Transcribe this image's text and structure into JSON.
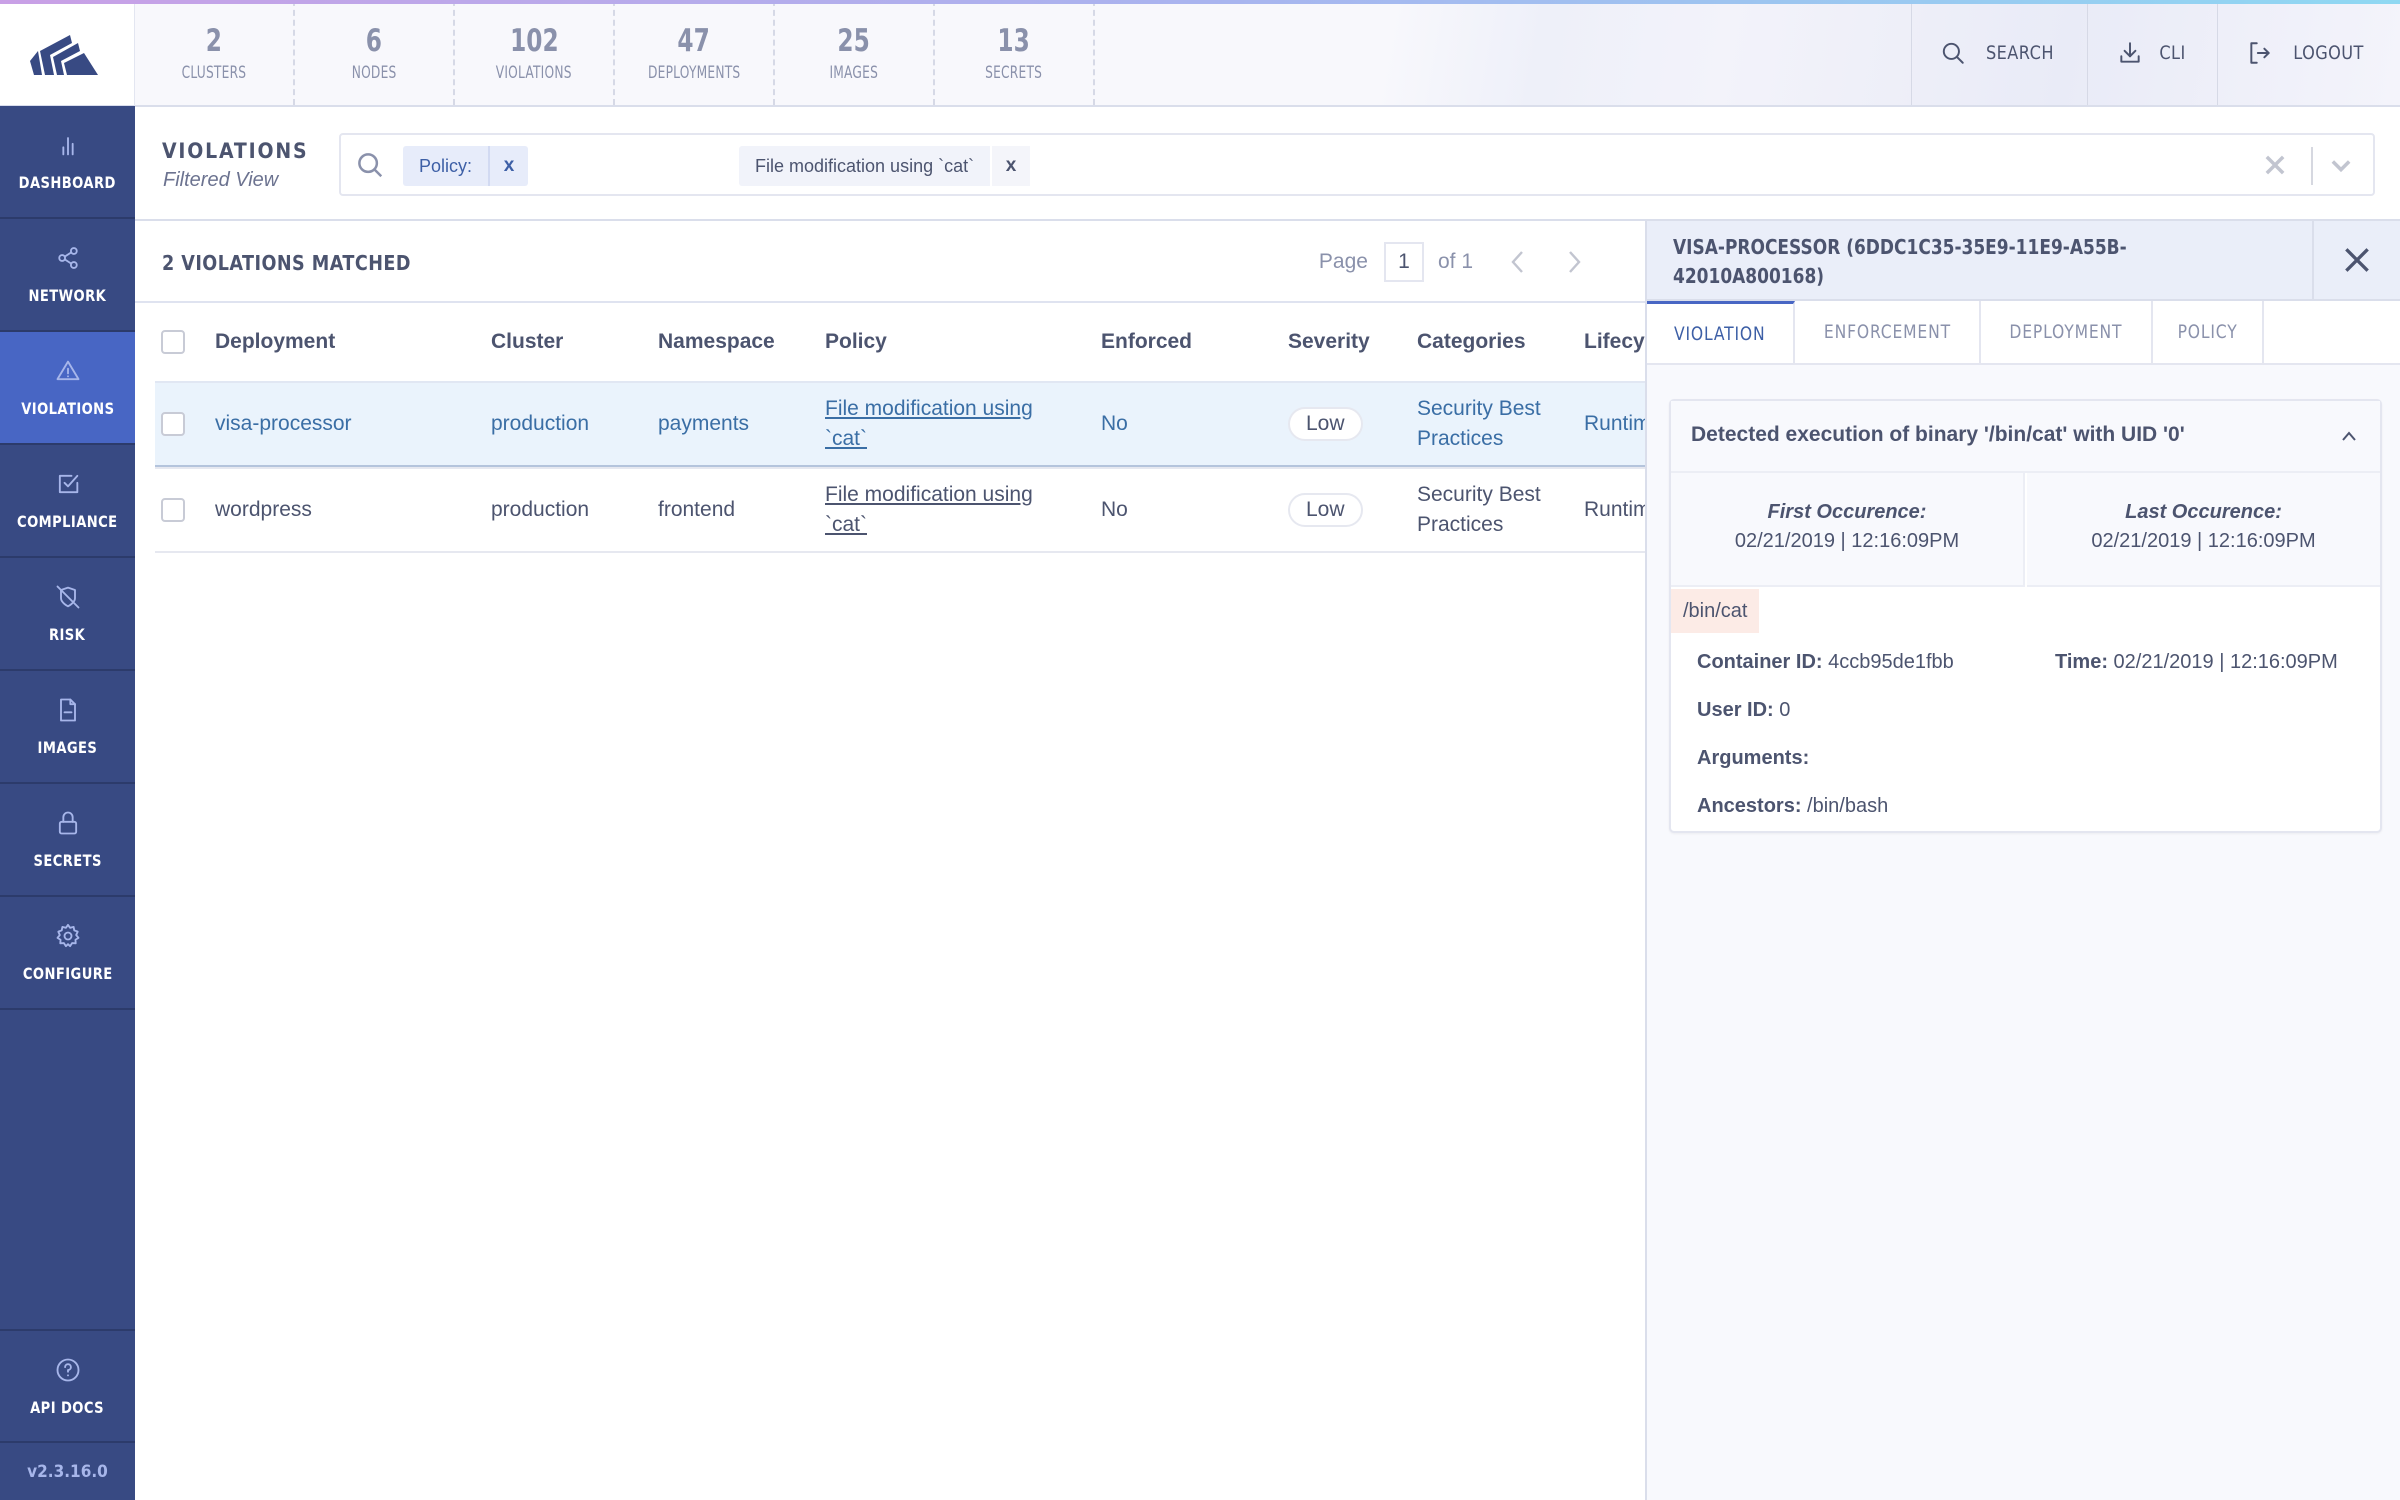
{
  "app": {
    "version": "v2.3.16.0"
  },
  "header": {
    "stats": [
      {
        "value": "2",
        "label": "CLUSTERS"
      },
      {
        "value": "6",
        "label": "NODES"
      },
      {
        "value": "102",
        "label": "VIOLATIONS"
      },
      {
        "value": "47",
        "label": "DEPLOYMENTS"
      },
      {
        "value": "25",
        "label": "IMAGES"
      },
      {
        "value": "13",
        "label": "SECRETS"
      }
    ],
    "buttons": {
      "search": "SEARCH",
      "cli": "CLI",
      "logout": "LOGOUT"
    }
  },
  "sidebar": {
    "items": [
      {
        "label": "DASHBOARD",
        "icon": "bar-chart-icon"
      },
      {
        "label": "NETWORK",
        "icon": "share-icon"
      },
      {
        "label": "VIOLATIONS",
        "icon": "alert-triangle-icon",
        "active": true
      },
      {
        "label": "COMPLIANCE",
        "icon": "check-square-icon"
      },
      {
        "label": "RISK",
        "icon": "shield-off-icon"
      },
      {
        "label": "IMAGES",
        "icon": "file-icon"
      },
      {
        "label": "SECRETS",
        "icon": "lock-icon"
      },
      {
        "label": "CONFIGURE",
        "icon": "gear-icon"
      }
    ],
    "api_docs": {
      "label": "API DOCS",
      "icon": "help-circle-icon"
    }
  },
  "page": {
    "title": "VIOLATIONS",
    "subtitle": "Filtered View",
    "search": {
      "chips": [
        {
          "key": "Policy:",
          "value": "File modification using `cat`"
        }
      ]
    }
  },
  "table": {
    "matched_label": "2 VIOLATIONS MATCHED",
    "pagination": {
      "page_label": "Page",
      "current_page": "1",
      "of_label": "of 1"
    },
    "columns": [
      "Deployment",
      "Cluster",
      "Namespace",
      "Policy",
      "Enforced",
      "Severity",
      "Categories",
      "Lifecycle"
    ],
    "rows": [
      {
        "deployment": "visa-processor",
        "cluster": "production",
        "namespace": "payments",
        "policy": "File modification using `cat`",
        "enforced": "No",
        "severity": "Low",
        "categories": "Security Best Practices",
        "lifecycle": "Runtime",
        "selected": true
      },
      {
        "deployment": "wordpress",
        "cluster": "production",
        "namespace": "frontend",
        "policy": "File modification using `cat`",
        "enforced": "No",
        "severity": "Low",
        "categories": "Security Best Practices",
        "lifecycle": "Runtime",
        "selected": false
      }
    ]
  },
  "detail_panel": {
    "title": "VISA-PROCESSOR (6DDC1C35-35E9-11E9-A55B-42010A800168)",
    "tabs": [
      {
        "label": "VIOLATION",
        "active": true
      },
      {
        "label": "ENFORCEMENT",
        "active": false
      },
      {
        "label": "DEPLOYMENT",
        "active": false
      },
      {
        "label": "POLICY",
        "active": false
      }
    ],
    "violation": {
      "title": "Detected execution of binary '/bin/cat' with UID '0'",
      "first_occurrence_label": "First Occurence:",
      "first_occurrence": "02/21/2019 | 12:16:09PM",
      "last_occurrence_label": "Last Occurence:",
      "last_occurrence": "02/21/2019 | 12:16:09PM",
      "process": "/bin/cat",
      "container_id_label": "Container ID:",
      "container_id": "4ccb95de1fbb",
      "time_label": "Time:",
      "time": "02/21/2019 | 12:16:09PM",
      "user_id_label": "User ID:",
      "user_id": "0",
      "arguments_label": "Arguments:",
      "arguments": "",
      "ancestors_label": "Ancestors:",
      "ancestors": "/bin/bash"
    }
  },
  "colors": {
    "sidebar_bg": "#384a83",
    "sidebar_active": "#4866c4",
    "selected_row_bg": "#eaf3fc",
    "selected_row_text": "#3a6ea5",
    "process_tag_bg": "#fcebe6"
  }
}
